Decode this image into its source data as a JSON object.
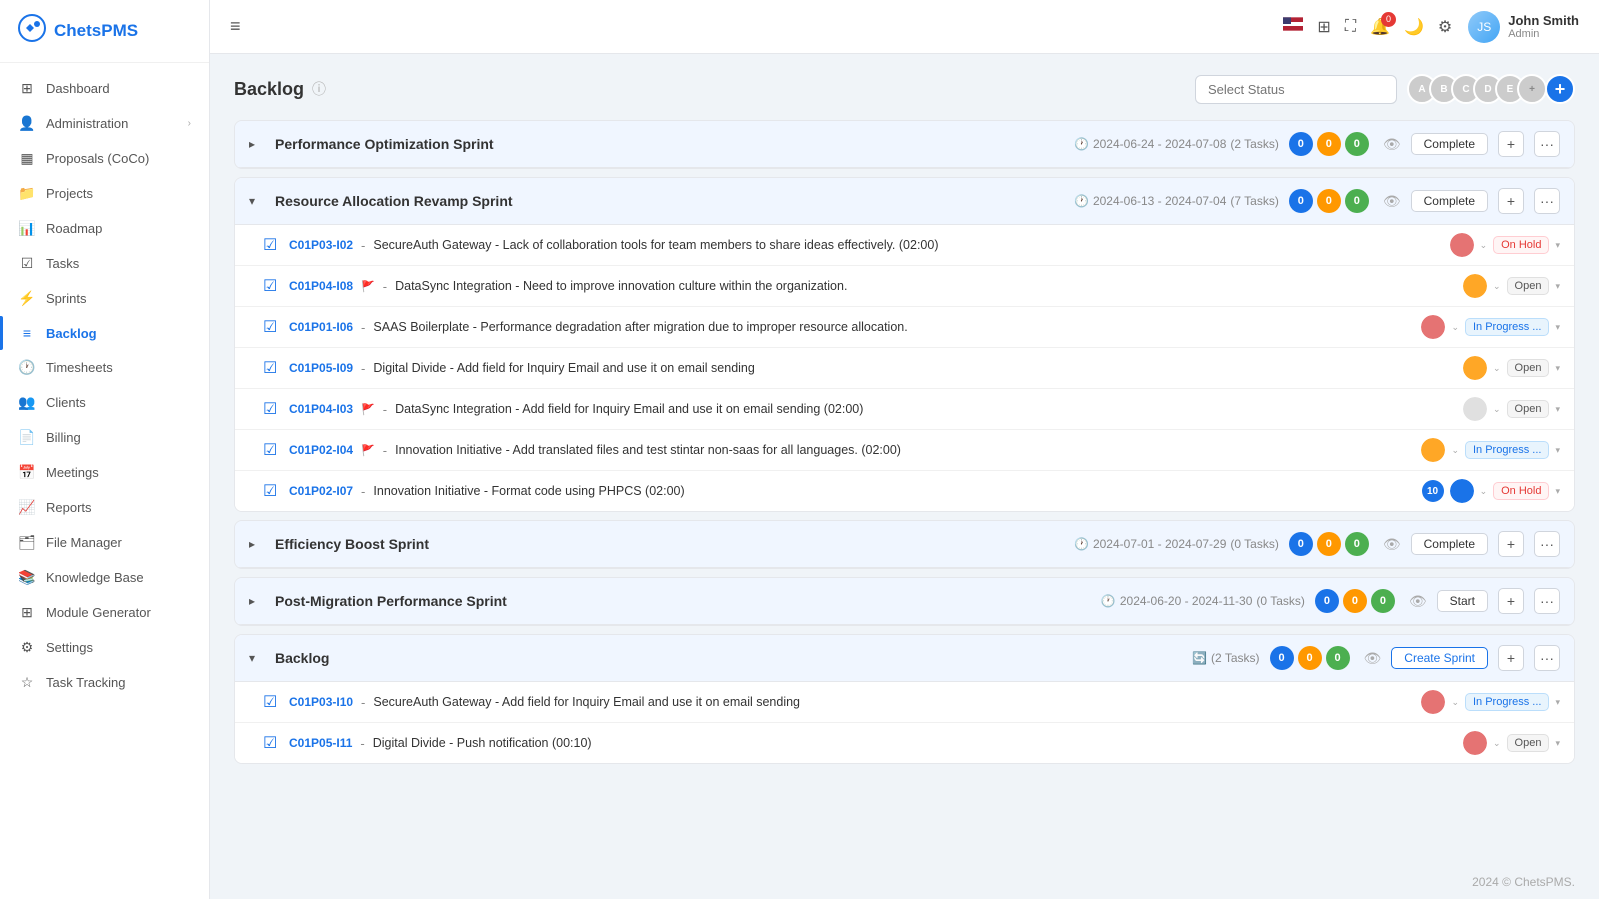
{
  "app": {
    "logo": "ChetsPMS",
    "logo_icon": "⚙"
  },
  "sidebar": {
    "items": [
      {
        "id": "dashboard",
        "label": "Dashboard",
        "icon": "⊞",
        "active": false
      },
      {
        "id": "administration",
        "label": "Administration",
        "icon": "👤",
        "active": false,
        "arrow": true
      },
      {
        "id": "proposals",
        "label": "Proposals (CoCo)",
        "icon": "▦",
        "active": false
      },
      {
        "id": "projects",
        "label": "Projects",
        "icon": "📁",
        "active": false
      },
      {
        "id": "roadmap",
        "label": "Roadmap",
        "icon": "📊",
        "active": false
      },
      {
        "id": "tasks",
        "label": "Tasks",
        "icon": "☑",
        "active": false
      },
      {
        "id": "sprints",
        "label": "Sprints",
        "icon": "⚡",
        "active": false
      },
      {
        "id": "backlog",
        "label": "Backlog",
        "icon": "≡",
        "active": true
      },
      {
        "id": "timesheets",
        "label": "Timesheets",
        "icon": "🕐",
        "active": false
      },
      {
        "id": "clients",
        "label": "Clients",
        "icon": "👥",
        "active": false
      },
      {
        "id": "billing",
        "label": "Billing",
        "icon": "📄",
        "active": false
      },
      {
        "id": "meetings",
        "label": "Meetings",
        "icon": "📅",
        "active": false
      },
      {
        "id": "reports",
        "label": "Reports",
        "icon": "📈",
        "active": false
      },
      {
        "id": "file-manager",
        "label": "File Manager",
        "icon": "🗂",
        "active": false
      },
      {
        "id": "knowledge-base",
        "label": "Knowledge Base",
        "icon": "📚",
        "active": false
      },
      {
        "id": "module-generator",
        "label": "Module Generator",
        "icon": "⊞",
        "active": false
      },
      {
        "id": "settings",
        "label": "Settings",
        "icon": "⚙",
        "active": false
      },
      {
        "id": "task-tracking",
        "label": "Task Tracking",
        "icon": "☆",
        "active": false
      }
    ]
  },
  "topbar": {
    "hamburger": "≡",
    "notification_count": "0",
    "user": {
      "name": "John Smith",
      "role": "Admin"
    }
  },
  "page": {
    "title": "Backlog",
    "info_icon": "ⓘ",
    "select_status_placeholder": "Select Status"
  },
  "sprints": [
    {
      "id": "sprint1",
      "name": "Performance Optimization Sprint",
      "date_range": "2024-06-24 - 2024-07-08",
      "task_count": "2 Tasks",
      "expanded": false,
      "counters": [
        0,
        0,
        0
      ],
      "button_label": "Complete",
      "button_type": "complete"
    },
    {
      "id": "sprint2",
      "name": "Resource Allocation Revamp Sprint",
      "date_range": "2024-06-13 - 2024-07-04",
      "task_count": "7 Tasks",
      "expanded": true,
      "counters": [
        0,
        0,
        0
      ],
      "button_label": "Complete",
      "button_type": "complete",
      "tasks": [
        {
          "id": "C01P03-I02",
          "flag": false,
          "text": "SecureAuth Gateway - Lack of collaboration tools for team members to share ideas effectively. (02:00)",
          "status": "On Hold",
          "status_type": "on-hold",
          "avatar_color": "av-1"
        },
        {
          "id": "C01P04-I08",
          "flag": true,
          "text": "DataSync Integration - Need to improve innovation culture within the organization.",
          "status": "Open",
          "status_type": "open",
          "avatar_color": "av-2"
        },
        {
          "id": "C01P01-I06",
          "flag": false,
          "text": "SAAS Boilerplate - Performance degradation after migration due to improper resource allocation.",
          "status": "In Progress ...",
          "status_type": "in-progress",
          "avatar_color": "av-1"
        },
        {
          "id": "C01P05-I09",
          "flag": false,
          "text": "Digital Divide - Add field for Inquiry Email and use it on email sending",
          "status": "Open",
          "status_type": "open",
          "avatar_color": "av-2"
        },
        {
          "id": "C01P04-I03",
          "flag": true,
          "text": "DataSync Integration - Add field for Inquiry Email and use it on email sending (02:00)",
          "status": "Open",
          "status_type": "open",
          "avatar_color": "blank"
        },
        {
          "id": "C01P02-I04",
          "flag": true,
          "text": "Innovation Initiative - Add translated files and test stintar non-saas for all languages. (02:00)",
          "status": "In Progress ...",
          "status_type": "in-progress",
          "avatar_color": "av-2"
        },
        {
          "id": "C01P02-I07",
          "flag": false,
          "text": "Innovation Initiative - Format code using PHPCS (02:00)",
          "status": "On Hold",
          "status_type": "on-hold",
          "avatar_color": "av-special",
          "badge_number": "10"
        }
      ]
    },
    {
      "id": "sprint3",
      "name": "Efficiency Boost Sprint",
      "date_range": "2024-07-01 - 2024-07-29",
      "task_count": "0 Tasks",
      "expanded": false,
      "counters": [
        0,
        0,
        0
      ],
      "button_label": "Complete",
      "button_type": "complete"
    },
    {
      "id": "sprint4",
      "name": "Post-Migration Performance Sprint",
      "date_range": "2024-06-20 - 2024-11-30",
      "task_count": "0 Tasks",
      "expanded": false,
      "counters": [
        0,
        0,
        0
      ],
      "button_label": "Start",
      "button_type": "start"
    },
    {
      "id": "backlog-section",
      "name": "Backlog",
      "task_count": "2 Tasks",
      "expanded": true,
      "counters": [
        0,
        0,
        0
      ],
      "button_label": "Create Sprint",
      "button_type": "create",
      "tasks": [
        {
          "id": "C01P03-I10",
          "flag": false,
          "text": "SecureAuth Gateway - Add field for Inquiry Email and use it on email sending",
          "status": "In Progress ...",
          "status_type": "in-progress",
          "avatar_color": "av-1"
        },
        {
          "id": "C01P05-I11",
          "flag": false,
          "text": "Digital Divide - Push notification (00:10)",
          "status": "Open",
          "status_type": "open",
          "avatar_color": "av-1"
        }
      ]
    }
  ],
  "footer": {
    "text": "2024 © ChetsPMS."
  }
}
